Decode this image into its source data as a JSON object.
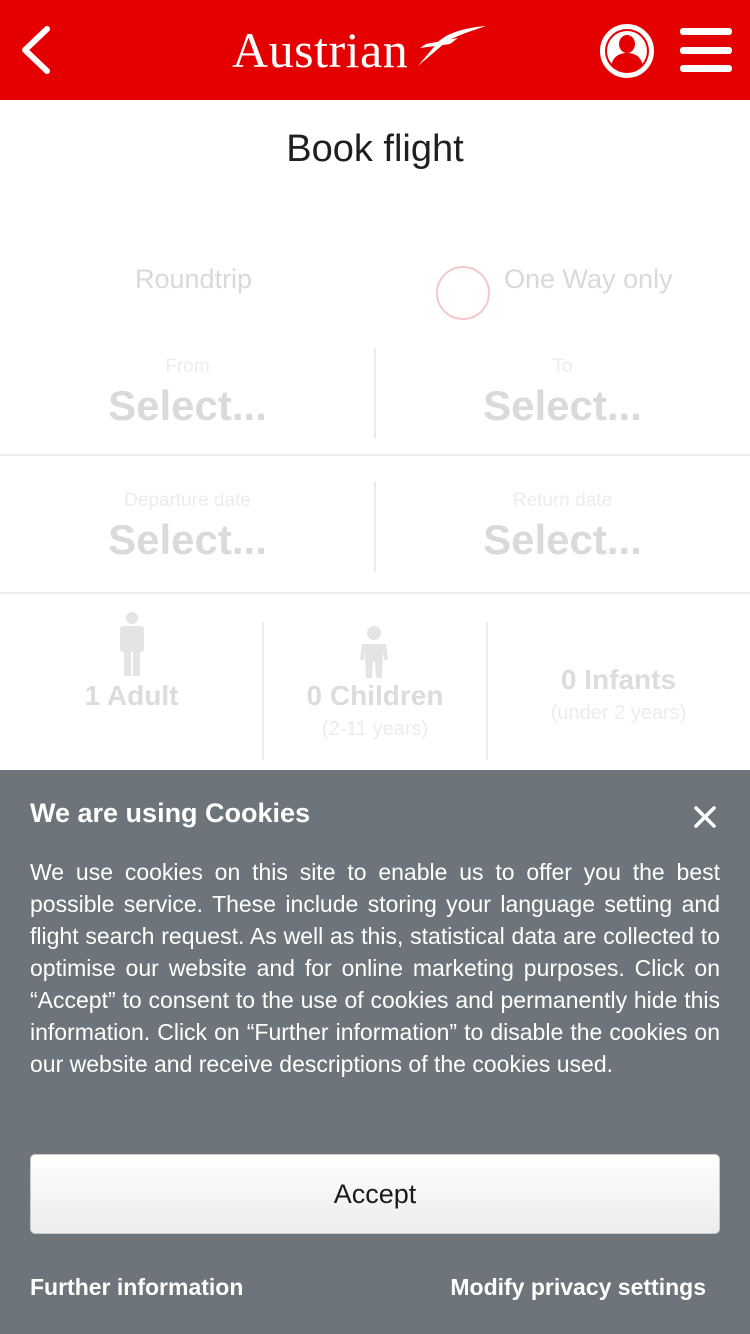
{
  "header": {
    "brand": "Austrian",
    "background_color": "#e40000",
    "icons": {
      "back": "chevron-left-icon",
      "profile": "user-icon",
      "menu": "hamburger-menu-icon"
    }
  },
  "page": {
    "title": "Book flight"
  },
  "trip_type": {
    "roundtrip_label": "Roundtrip",
    "oneway_label": "One Way only"
  },
  "route": {
    "from_label": "From",
    "from_value": "Select...",
    "to_label": "To",
    "to_value": "Select..."
  },
  "dates": {
    "departure_label": "Departure date",
    "departure_value": "Select...",
    "return_label": "Return date",
    "return_value": "Select..."
  },
  "passengers": {
    "adults": "1 Adult",
    "children": "0 Children",
    "children_note": "(2-11 years)",
    "infants": "0 Infants",
    "infants_note": "(under 2 years)"
  },
  "cookie_banner": {
    "title": "We are using Cookies",
    "text": "We use cookies on this site to enable us to offer you the best possible service. These include storing your language setting and flight search request. As well as this, statistical data are collected to optimise our website and for online marketing purposes. Click on “Accept” to consent to the use of cookies and permanently hide this information. Click on “Further information” to disable the cookies on our website and receive descriptions of the cookies used.",
    "accept_label": "Accept",
    "further_info_label": "Further information",
    "modify_privacy_label": "Modify privacy settings",
    "background_color": "#6d747a"
  }
}
